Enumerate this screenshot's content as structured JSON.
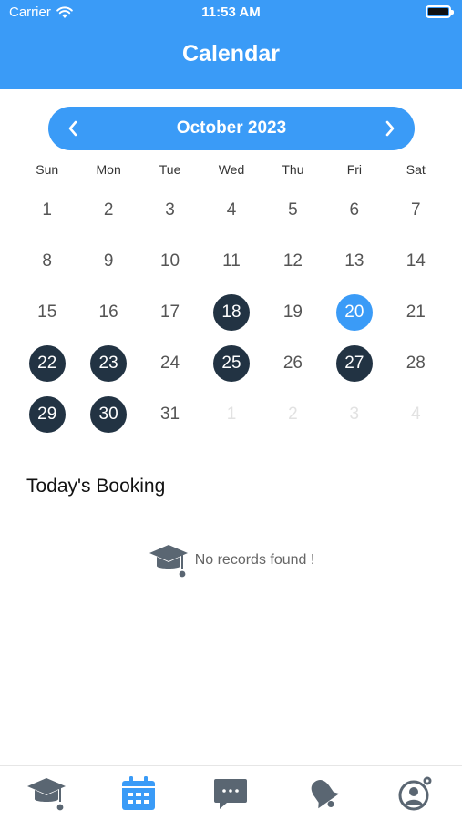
{
  "status_bar": {
    "carrier": "Carrier",
    "time": "11:53 AM"
  },
  "header": {
    "title": "Calendar"
  },
  "calendar": {
    "month_label": "October 2023",
    "weekdays": [
      "Sun",
      "Mon",
      "Tue",
      "Wed",
      "Thu",
      "Fri",
      "Sat"
    ],
    "days": [
      {
        "label": "1",
        "state": "normal"
      },
      {
        "label": "2",
        "state": "normal"
      },
      {
        "label": "3",
        "state": "normal"
      },
      {
        "label": "4",
        "state": "normal"
      },
      {
        "label": "5",
        "state": "normal"
      },
      {
        "label": "6",
        "state": "normal"
      },
      {
        "label": "7",
        "state": "normal"
      },
      {
        "label": "8",
        "state": "normal"
      },
      {
        "label": "9",
        "state": "normal"
      },
      {
        "label": "10",
        "state": "normal"
      },
      {
        "label": "11",
        "state": "normal"
      },
      {
        "label": "12",
        "state": "normal"
      },
      {
        "label": "13",
        "state": "normal"
      },
      {
        "label": "14",
        "state": "normal"
      },
      {
        "label": "15",
        "state": "normal"
      },
      {
        "label": "16",
        "state": "normal"
      },
      {
        "label": "17",
        "state": "normal"
      },
      {
        "label": "18",
        "state": "booked"
      },
      {
        "label": "19",
        "state": "normal"
      },
      {
        "label": "20",
        "state": "today"
      },
      {
        "label": "21",
        "state": "normal"
      },
      {
        "label": "22",
        "state": "booked"
      },
      {
        "label": "23",
        "state": "booked"
      },
      {
        "label": "24",
        "state": "normal"
      },
      {
        "label": "25",
        "state": "booked"
      },
      {
        "label": "26",
        "state": "normal"
      },
      {
        "label": "27",
        "state": "booked"
      },
      {
        "label": "28",
        "state": "normal"
      },
      {
        "label": "29",
        "state": "booked"
      },
      {
        "label": "30",
        "state": "booked"
      },
      {
        "label": "31",
        "state": "normal"
      },
      {
        "label": "1",
        "state": "muted"
      },
      {
        "label": "2",
        "state": "muted"
      },
      {
        "label": "3",
        "state": "muted"
      },
      {
        "label": "4",
        "state": "muted"
      }
    ]
  },
  "bookings": {
    "title": "Today's Booking",
    "empty_text": "No records found !",
    "empty_icon": "graduation-cap-icon"
  },
  "tabs": [
    {
      "icon": "graduation-cap-icon",
      "active": false
    },
    {
      "icon": "calendar-icon",
      "active": true
    },
    {
      "icon": "chat-icon",
      "active": false
    },
    {
      "icon": "bell-icon",
      "active": false
    },
    {
      "icon": "profile-settings-icon",
      "active": false
    }
  ],
  "colors": {
    "accent": "#3a9bf7",
    "booked": "#223343",
    "icon_gray": "#5a6672"
  }
}
